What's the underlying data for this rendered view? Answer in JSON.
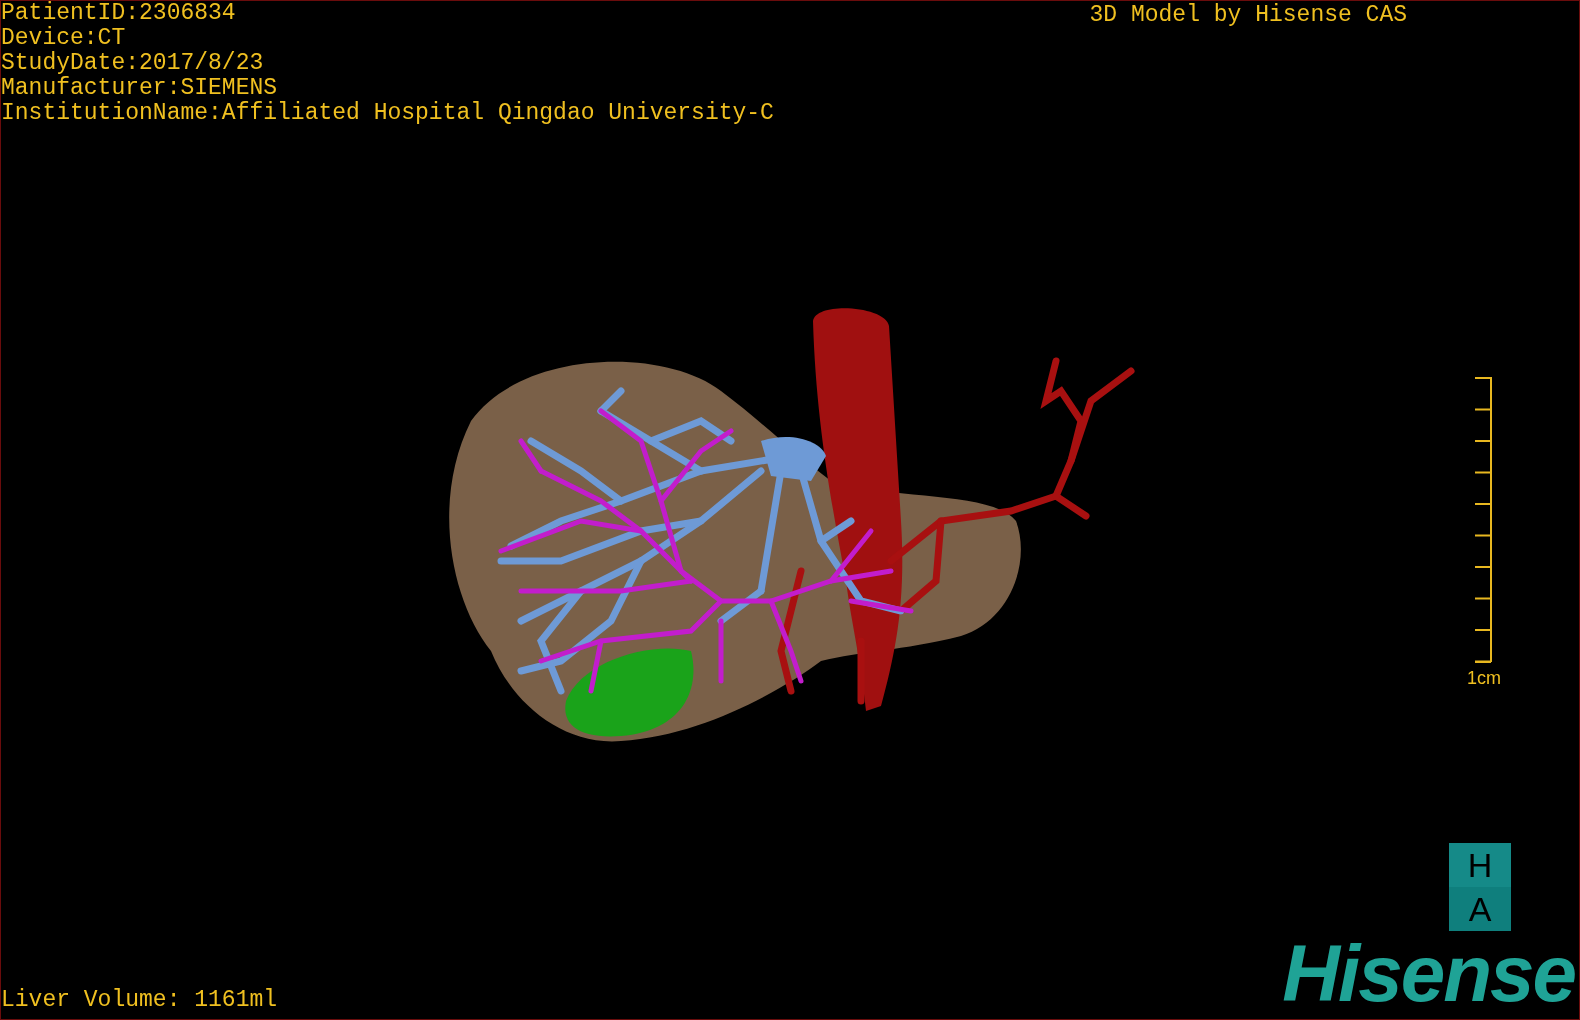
{
  "patient_info": [
    "PatientID:2306834",
    "Device:CT",
    "StudyDate:2017/8/23",
    "Manufacturer:SIEMENS",
    "InstitutionName:Affiliated Hospital Qingdao University-C"
  ],
  "title": "3D Model by Hisense CAS",
  "scale_bar": {
    "label": "1cm"
  },
  "measurement": "Liver Volume: 1161ml",
  "logo": {
    "badge_letters": [
      "H",
      "A"
    ],
    "wordmark": "Hisense"
  }
}
